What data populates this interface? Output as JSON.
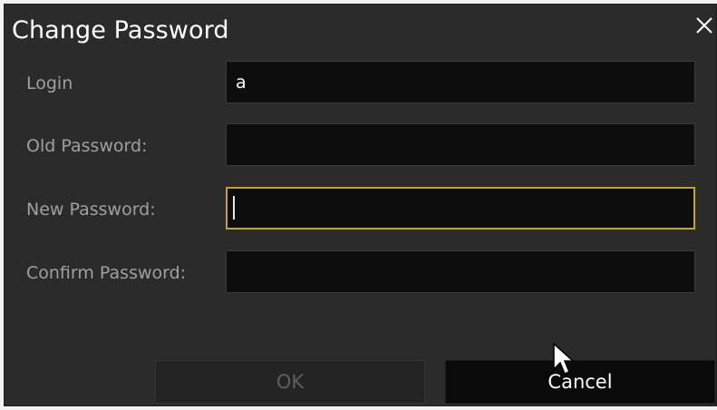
{
  "dialog": {
    "title": "Change Password",
    "close_icon": "close-icon"
  },
  "form": {
    "login_label": "Login",
    "login_value": "a",
    "old_password_label": "Old Password:",
    "old_password_value": "",
    "new_password_label": "New Password:",
    "new_password_value": "",
    "confirm_password_label": "Confirm Password:",
    "confirm_password_value": ""
  },
  "buttons": {
    "ok_label": "OK",
    "cancel_label": "Cancel"
  },
  "colors": {
    "background": "#2b2b2b",
    "field_background": "#0d0d0d",
    "focus_border": "#c8a418",
    "label_text": "#a0a0a0",
    "disabled_text": "#5f5f5f"
  }
}
